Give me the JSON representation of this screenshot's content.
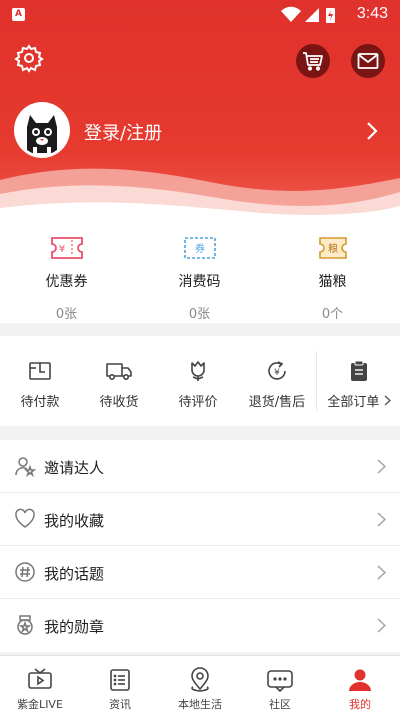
{
  "status_bar": {
    "time": "3:43",
    "app_icon_letter": "A"
  },
  "header": {
    "login_label": "登录/注册",
    "icons": {
      "settings": "gear-icon",
      "cart": "cart-icon",
      "mail": "mail-icon"
    }
  },
  "assets": [
    {
      "label": "优惠券",
      "value": "0张",
      "icon": "coupon-icon",
      "icon_text": "¥"
    },
    {
      "label": "消费码",
      "value": "0张",
      "icon": "voucher-icon",
      "icon_text": "券"
    },
    {
      "label": "猫粮",
      "value": "0个",
      "icon": "cat-food-icon",
      "icon_text": "粮"
    }
  ],
  "orders": [
    {
      "label": "待付款",
      "icon": "wallet-icon"
    },
    {
      "label": "待收货",
      "icon": "truck-icon"
    },
    {
      "label": "待评价",
      "icon": "flower-icon"
    },
    {
      "label": "退货/售后",
      "icon": "refund-icon"
    }
  ],
  "all_orders_label": "全部订单",
  "menu": [
    {
      "label": "邀请达人",
      "icon": "invite-icon"
    },
    {
      "label": "我的收藏",
      "icon": "heart-icon"
    },
    {
      "label": "我的话题",
      "icon": "hashtag-icon"
    },
    {
      "label": "我的勋章",
      "icon": "medal-icon"
    }
  ],
  "tabs": [
    {
      "label": "紫金LIVE",
      "icon": "tv-play-icon"
    },
    {
      "label": "资讯",
      "icon": "news-icon"
    },
    {
      "label": "本地生活",
      "icon": "location-icon"
    },
    {
      "label": "社区",
      "icon": "chat-icon"
    },
    {
      "label": "我的",
      "icon": "person-icon",
      "active": true
    }
  ],
  "colors": {
    "brand_red": "#e0312c",
    "dark_red": "#7a1513",
    "coupon_pink": "#e8526a",
    "voucher_blue": "#4aa3df",
    "food_gold": "#d39a2a"
  }
}
